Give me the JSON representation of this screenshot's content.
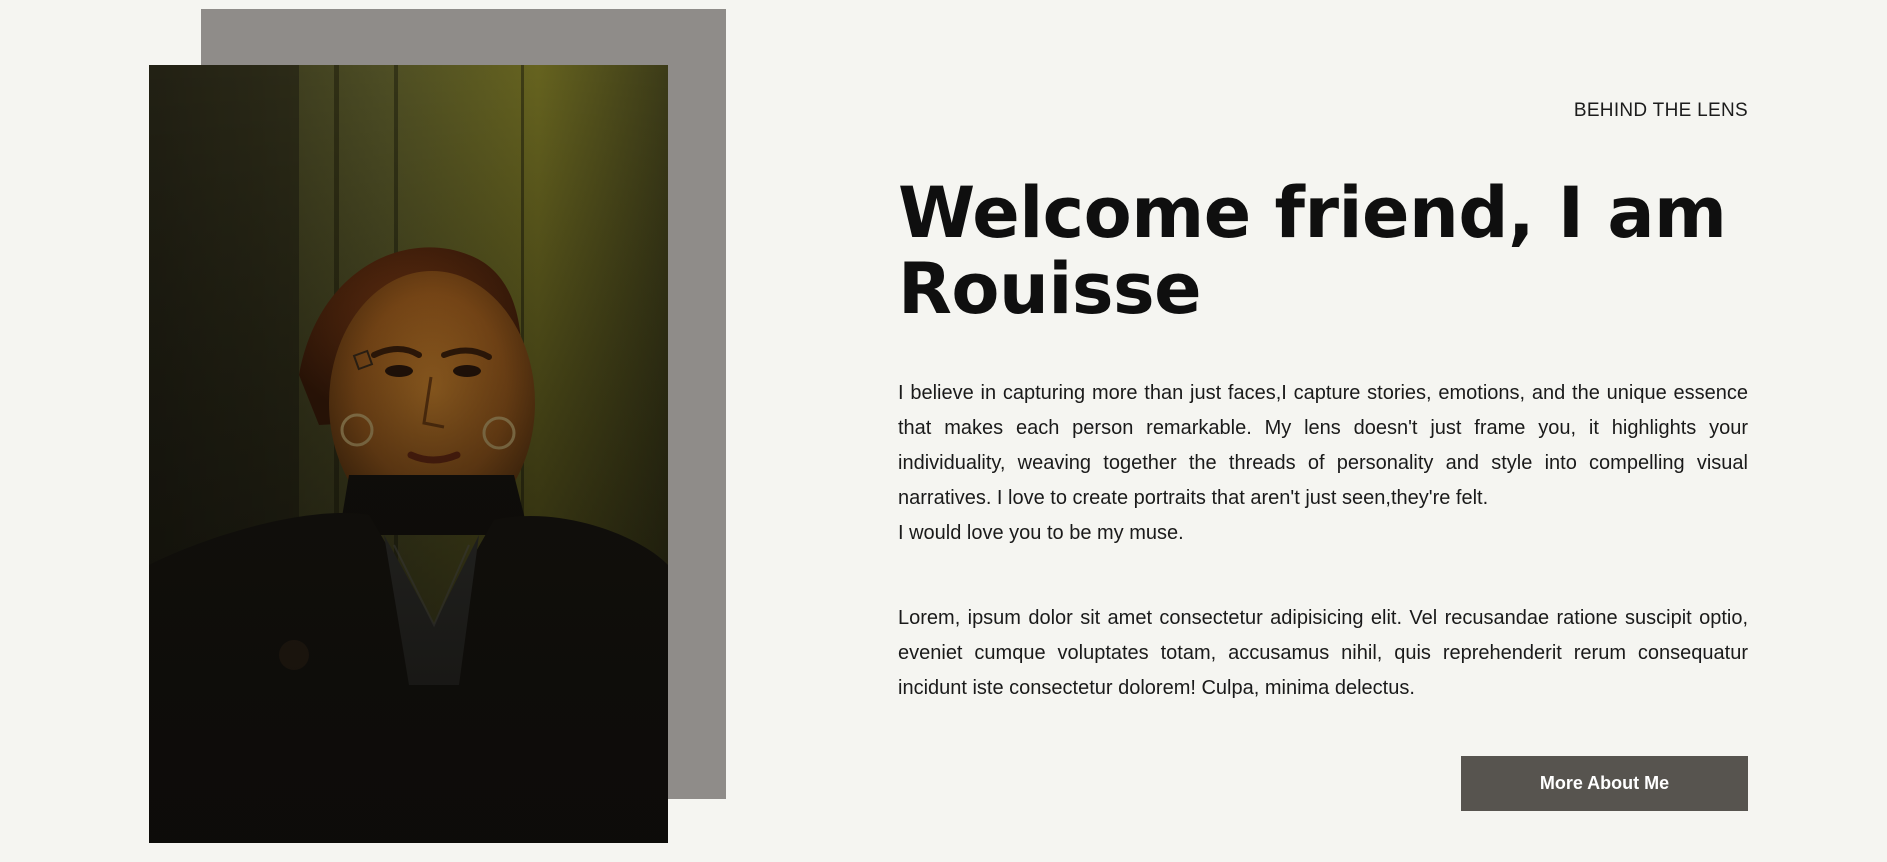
{
  "section": {
    "eyebrow": "BEHIND THE LENS",
    "headline": "Welcome friend, I am Rouisse",
    "paragraph_1": "I believe in capturing more than just faces,I capture stories, emotions, and the unique essence that makes each person remarkable. My lens doesn't just frame you, it highlights your individuality, weaving together the threads of personality and style into compelling visual narratives. I love to create portraits that aren't just seen,they're felt.",
    "paragraph_1_closing": "I would love you to be my muse.",
    "paragraph_2": "Lorem, ipsum dolor sit amet consectetur adipisicing elit. Vel recusandae ratione suscipit optio, eveniet cumque voluptates totam, accusamus nihil, quis reprehenderit rerum consequatur incidunt iste consectetur dolorem! Culpa, minima delectus.",
    "cta_label": "More About Me"
  },
  "colors": {
    "page_background": "#f5f5f1",
    "backdrop_panel": "#8f8c89",
    "button_background": "#57544f",
    "button_text": "#ffffff",
    "heading_text": "#0f0f0f"
  }
}
